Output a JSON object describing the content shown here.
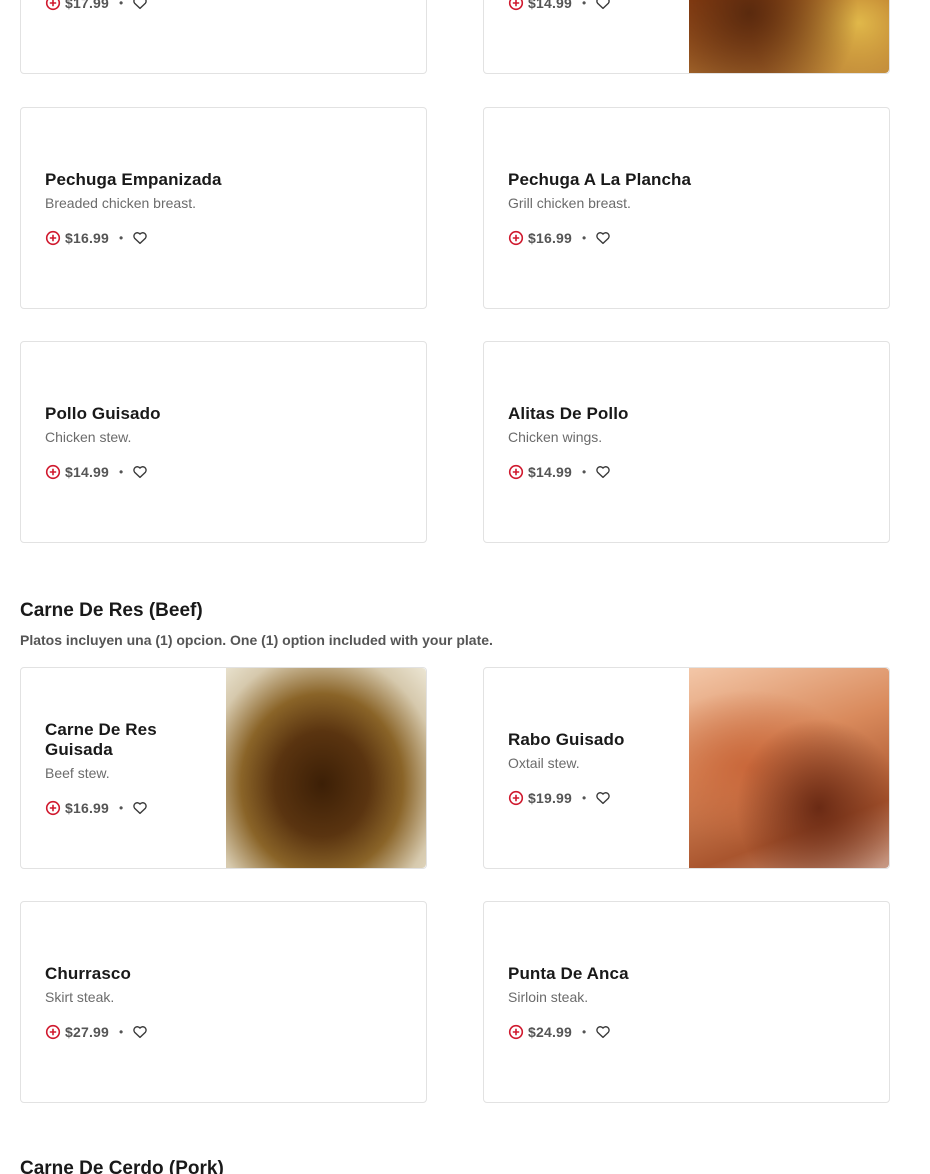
{
  "top_row": [
    {
      "price": "$17.99"
    },
    {
      "price": "$14.99"
    }
  ],
  "pollo_items": [
    {
      "name": "Pechuga Empanizada",
      "description": "Breaded chicken breast.",
      "price": "$16.99"
    },
    {
      "name": "Pechuga A La Plancha",
      "description": "Grill chicken breast.",
      "price": "$16.99"
    },
    {
      "name": "Pollo Guisado",
      "description": "Chicken stew.",
      "price": "$14.99"
    },
    {
      "name": "Alitas De Pollo",
      "description": "Chicken wings.",
      "price": "$14.99"
    }
  ],
  "beef_section": {
    "title": "Carne De Res (Beef)",
    "subtitle": "Platos incluyen una (1) opcion. One (1) option included with your plate.",
    "items": [
      {
        "name": "Carne De Res Guisada",
        "description": "Beef stew.",
        "price": "$16.99"
      },
      {
        "name": "Rabo Guisado",
        "description": "Oxtail stew.",
        "price": "$19.99"
      },
      {
        "name": "Churrasco",
        "description": "Skirt steak.",
        "price": "$27.99"
      },
      {
        "name": "Punta De Anca",
        "description": "Sirloin steak.",
        "price": "$24.99"
      }
    ]
  },
  "pork_section": {
    "title": "Carne De Cerdo (Pork)"
  },
  "separator": "•",
  "icons": {
    "add": "add-circle-icon",
    "favorite": "heart-icon"
  },
  "colors": {
    "accent": "#d0192e",
    "text": "#191919",
    "muted": "#6b6b6b"
  }
}
